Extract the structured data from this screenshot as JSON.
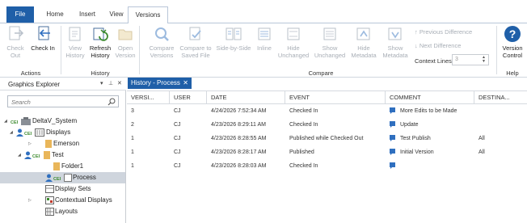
{
  "ribbon_tabs": [
    "File",
    "Home",
    "Insert",
    "View",
    "Versions"
  ],
  "ribbon": {
    "actions": {
      "check_out": "Check Out",
      "check_in": "Check In",
      "group_label": "Actions"
    },
    "history": {
      "view_history": "View History",
      "refresh_history": "Refresh History",
      "open_version": "Open Version",
      "group_label": "History"
    },
    "compare": {
      "compare_versions": "Compare Versions",
      "compare_saved": "Compare to Saved File",
      "side_by_side": "Side-by-Side",
      "inline": "Inline",
      "hide_unchanged": "Hide Unchanged",
      "show_unchanged": "Show Unchanged",
      "hide_metadata": "Hide Metadata",
      "show_metadata": "Show Metadata",
      "prev_diff": "Previous Difference",
      "next_diff": "Next Difference",
      "context_lines_label": "Context Lines",
      "context_lines_value": "3",
      "group_label": "Compare"
    },
    "help": {
      "version_control": "Version Control",
      "group_label": "Help"
    }
  },
  "explorer": {
    "title": "Graphics Explorer",
    "search_placeholder": "Search",
    "tree": [
      {
        "label": "DeltaV_System"
      },
      {
        "label": "Displays"
      },
      {
        "label": "Emerson"
      },
      {
        "label": "Test"
      },
      {
        "label": "Folder1"
      },
      {
        "label": "Process"
      },
      {
        "label": "Display Sets"
      },
      {
        "label": "Contextual Displays"
      },
      {
        "label": "Layouts"
      }
    ]
  },
  "doc_tab": {
    "label": "History - Process"
  },
  "history_grid": {
    "columns": [
      "VERSI...",
      "USER",
      "DATE",
      "EVENT",
      "COMMENT",
      "DESTINA..."
    ],
    "rows": [
      {
        "version": "3",
        "user": "CJ",
        "date": "4/24/2026 7:52:34 AM",
        "event": "Checked In",
        "comment": "More Edits to be Made",
        "destination": ""
      },
      {
        "version": "2",
        "user": "CJ",
        "date": "4/23/2026 8:29:11 AM",
        "event": "Checked In",
        "comment": "Update",
        "destination": ""
      },
      {
        "version": "1",
        "user": "CJ",
        "date": "4/23/2026 8:28:55 AM",
        "event": "Published while Checked Out",
        "comment": "Test Publish",
        "destination": "All"
      },
      {
        "version": "1",
        "user": "CJ",
        "date": "4/23/2026 8:28:17 AM",
        "event": "Published",
        "comment": "Initial Version",
        "destination": "All"
      },
      {
        "version": "1",
        "user": "CJ",
        "date": "4/23/2026 8:28:03 AM",
        "event": "Checked In",
        "comment": "",
        "destination": ""
      }
    ]
  }
}
